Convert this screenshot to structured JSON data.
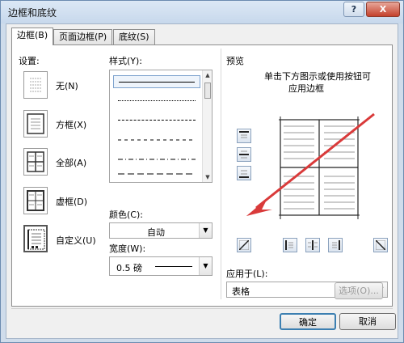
{
  "window": {
    "title": "边框和底纹",
    "help_label": "?",
    "close_label": "X"
  },
  "tabs": [
    {
      "label": "边框(B)"
    },
    {
      "label": "页面边框(P)"
    },
    {
      "label": "底纹(S)"
    }
  ],
  "settings": {
    "heading": "设置:",
    "items": [
      {
        "label": "无(N)",
        "icon": "border-none-icon"
      },
      {
        "label": "方框(X)",
        "icon": "border-box-icon"
      },
      {
        "label": "全部(A)",
        "icon": "border-all-icon"
      },
      {
        "label": "虚框(D)",
        "icon": "border-grid-icon"
      },
      {
        "label": "自定义(U)",
        "icon": "border-custom-icon",
        "selected": true
      }
    ]
  },
  "style": {
    "heading": "样式(Y):",
    "items": [
      "solid",
      "dotted",
      "dashed-fine",
      "dashed",
      "dash-dot",
      "long-dash"
    ]
  },
  "color": {
    "heading": "颜色(C):",
    "value": "自动"
  },
  "width": {
    "heading": "宽度(W):",
    "value": "0.5 磅"
  },
  "preview": {
    "heading": "预览",
    "hint_line1": "单击下方图示或使用按钮可",
    "hint_line2": "应用边框"
  },
  "apply_to": {
    "heading": "应用于(L):",
    "value": "表格"
  },
  "buttons": {
    "options": "选项(O)...",
    "ok": "确定",
    "cancel": "取消"
  },
  "annotation": {
    "arrow_color": "#d93a3a"
  }
}
